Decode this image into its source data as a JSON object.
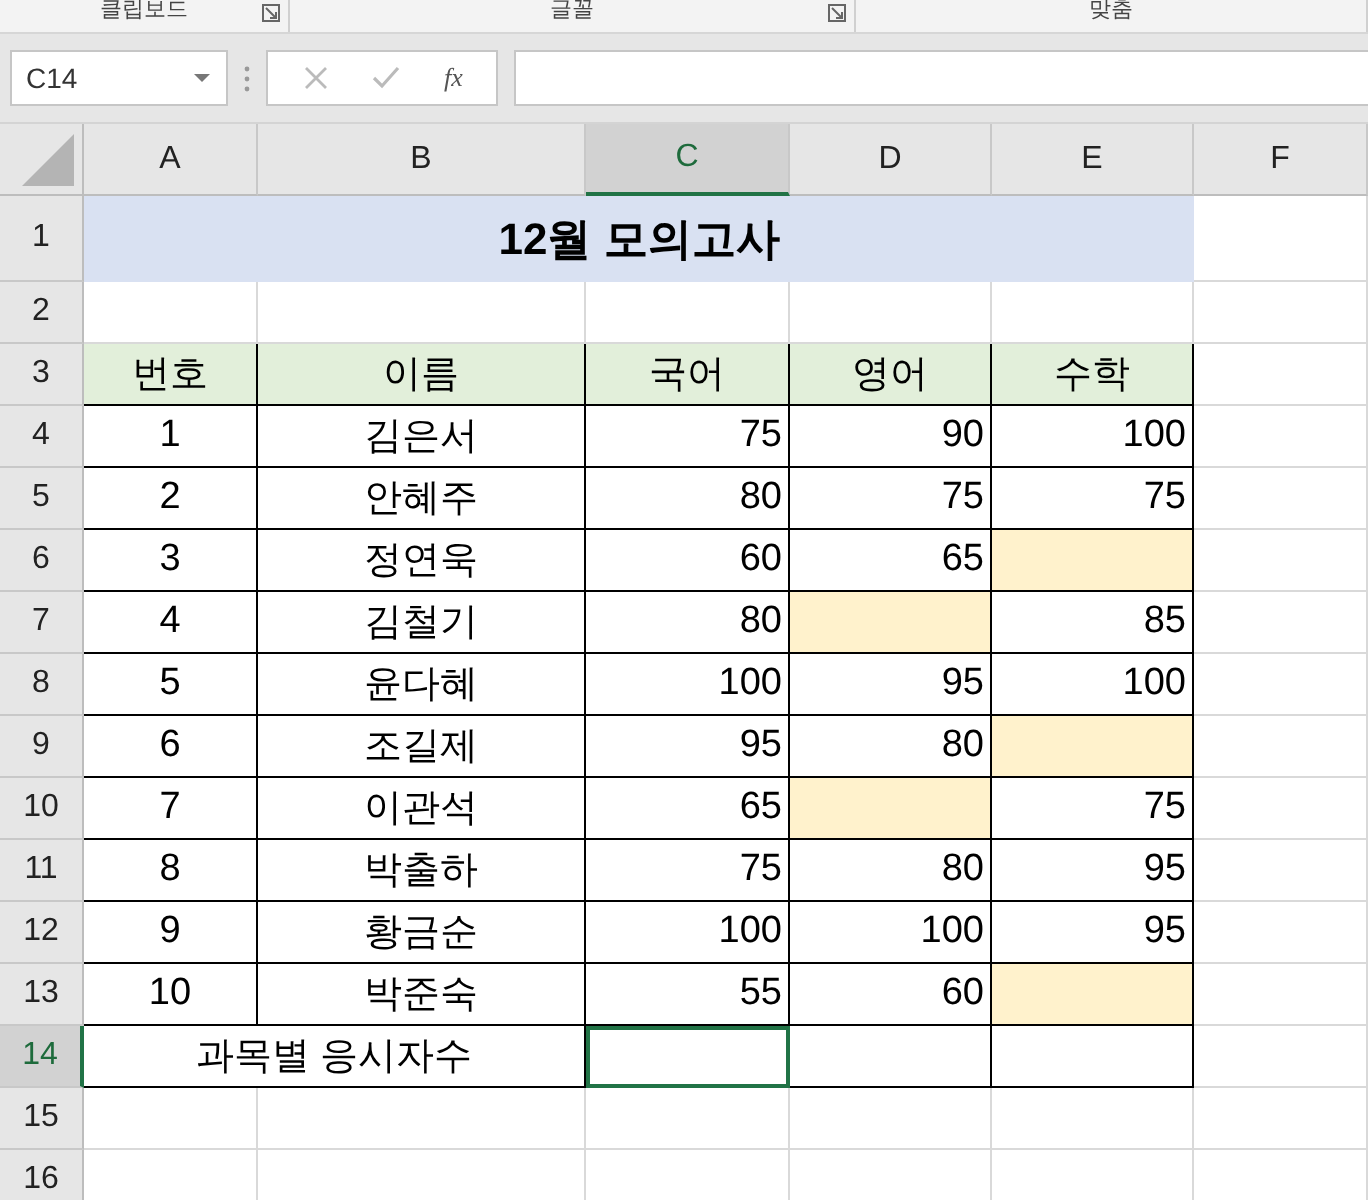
{
  "ribbon_groups": [
    {
      "label": "클립보드",
      "launcher": true
    },
    {
      "label": "글꼴",
      "launcher": true
    },
    {
      "label": "맞춤",
      "launcher": false
    }
  ],
  "formula_bar": {
    "name_box": "C14",
    "fx": "fx"
  },
  "columns": [
    {
      "label": "A",
      "selected": false
    },
    {
      "label": "B",
      "selected": false
    },
    {
      "label": "C",
      "selected": true
    },
    {
      "label": "D",
      "selected": false
    },
    {
      "label": "E",
      "selected": false
    },
    {
      "label": "F",
      "selected": false
    }
  ],
  "rows": [
    {
      "number": "1",
      "kind": "title",
      "selected": false,
      "title": "12월 모의고사"
    },
    {
      "number": "2",
      "kind": "blank",
      "selected": false
    },
    {
      "number": "3",
      "kind": "header",
      "selected": false,
      "cells": [
        {
          "value": "번호"
        },
        {
          "value": "이름"
        },
        {
          "value": "국어"
        },
        {
          "value": "영어"
        },
        {
          "value": "수학"
        }
      ]
    },
    {
      "number": "4",
      "kind": "data",
      "selected": false,
      "cells": [
        {
          "value": "1",
          "highlighted": false
        },
        {
          "value": "김은서",
          "highlighted": false
        },
        {
          "value": "75",
          "highlighted": false
        },
        {
          "value": "90",
          "highlighted": false
        },
        {
          "value": "100",
          "highlighted": false
        }
      ]
    },
    {
      "number": "5",
      "kind": "data",
      "selected": false,
      "cells": [
        {
          "value": "2",
          "highlighted": false
        },
        {
          "value": "안혜주",
          "highlighted": false
        },
        {
          "value": "80",
          "highlighted": false
        },
        {
          "value": "75",
          "highlighted": false
        },
        {
          "value": "75",
          "highlighted": false
        }
      ]
    },
    {
      "number": "6",
      "kind": "data",
      "selected": false,
      "cells": [
        {
          "value": "3",
          "highlighted": false
        },
        {
          "value": "정연욱",
          "highlighted": false
        },
        {
          "value": "60",
          "highlighted": false
        },
        {
          "value": "65",
          "highlighted": false
        },
        {
          "highlighted": true
        }
      ]
    },
    {
      "number": "7",
      "kind": "data",
      "selected": false,
      "cells": [
        {
          "value": "4",
          "highlighted": false
        },
        {
          "value": "김철기",
          "highlighted": false
        },
        {
          "value": "80",
          "highlighted": false
        },
        {
          "highlighted": true
        },
        {
          "value": "85",
          "highlighted": false
        }
      ]
    },
    {
      "number": "8",
      "kind": "data",
      "selected": false,
      "cells": [
        {
          "value": "5",
          "highlighted": false
        },
        {
          "value": "윤다혜",
          "highlighted": false
        },
        {
          "value": "100",
          "highlighted": false
        },
        {
          "value": "95",
          "highlighted": false
        },
        {
          "value": "100",
          "highlighted": false
        }
      ]
    },
    {
      "number": "9",
      "kind": "data",
      "selected": false,
      "cells": [
        {
          "value": "6",
          "highlighted": false
        },
        {
          "value": "조길제",
          "highlighted": false
        },
        {
          "value": "95",
          "highlighted": false
        },
        {
          "value": "80",
          "highlighted": false
        },
        {
          "highlighted": true
        }
      ]
    },
    {
      "number": "10",
      "kind": "data",
      "selected": false,
      "cells": [
        {
          "value": "7",
          "highlighted": false
        },
        {
          "value": "이관석",
          "highlighted": false
        },
        {
          "value": "65",
          "highlighted": false
        },
        {
          "highlighted": true
        },
        {
          "value": "75",
          "highlighted": false
        }
      ]
    },
    {
      "number": "11",
      "kind": "data",
      "selected": false,
      "cells": [
        {
          "value": "8",
          "highlighted": false
        },
        {
          "value": "박출하",
          "highlighted": false
        },
        {
          "value": "75",
          "highlighted": false
        },
        {
          "value": "80",
          "highlighted": false
        },
        {
          "value": "95",
          "highlighted": false
        }
      ]
    },
    {
      "number": "12",
      "kind": "data",
      "selected": false,
      "cells": [
        {
          "value": "9",
          "highlighted": false
        },
        {
          "value": "황금순",
          "highlighted": false
        },
        {
          "value": "100",
          "highlighted": false
        },
        {
          "value": "100",
          "highlighted": false
        },
        {
          "value": "95",
          "highlighted": false
        }
      ]
    },
    {
      "number": "13",
      "kind": "data",
      "selected": false,
      "cells": [
        {
          "value": "10",
          "highlighted": false
        },
        {
          "value": "박준숙",
          "highlighted": false
        },
        {
          "value": "55",
          "highlighted": false
        },
        {
          "value": "60",
          "highlighted": false
        },
        {
          "highlighted": true
        }
      ]
    },
    {
      "number": "14",
      "kind": "total",
      "selected": true,
      "label": "과목별 응시자수",
      "cells": [
        {
          "selected": true
        },
        {
          "selected": false
        },
        {
          "selected": false
        }
      ]
    },
    {
      "number": "15",
      "kind": "blank",
      "selected": false
    },
    {
      "number": "16",
      "kind": "blank",
      "selected": false
    }
  ]
}
